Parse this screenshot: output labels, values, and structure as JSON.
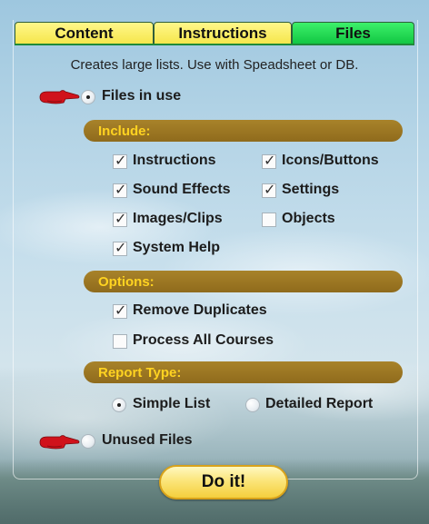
{
  "tabs": [
    {
      "label": "Content"
    },
    {
      "label": "Instructions"
    },
    {
      "label": "Files",
      "active": true
    }
  ],
  "description": "Creates large lists. Use with Speadsheet or DB.",
  "mode": {
    "files_in_use": {
      "label": "Files in use",
      "selected": true
    },
    "unused_files": {
      "label": "Unused Files",
      "selected": false
    }
  },
  "include": {
    "header": "Include:",
    "items": [
      {
        "label": "Instructions",
        "checked": true
      },
      {
        "label": "Icons/Buttons",
        "checked": true
      },
      {
        "label": "Sound Effects",
        "checked": true
      },
      {
        "label": "Settings",
        "checked": true
      },
      {
        "label": "Images/Clips",
        "checked": true
      },
      {
        "label": "Objects",
        "checked": false
      },
      {
        "label": "System Help",
        "checked": true
      }
    ]
  },
  "options": {
    "header": "Options:",
    "items": [
      {
        "label": "Remove Duplicates",
        "checked": true
      },
      {
        "label": "Process All Courses",
        "checked": false
      }
    ]
  },
  "report_type": {
    "header": "Report Type:",
    "items": [
      {
        "label": "Simple List",
        "selected": true
      },
      {
        "label": "Detailed Report",
        "selected": false
      }
    ]
  },
  "action": {
    "label": "Do it!"
  },
  "colors": {
    "active_tab": "#12c743",
    "inactive_tab": "#f5e64c",
    "section_bar": "#8f6b1c",
    "section_text": "#ffd321",
    "pointer": "#d0121b"
  }
}
